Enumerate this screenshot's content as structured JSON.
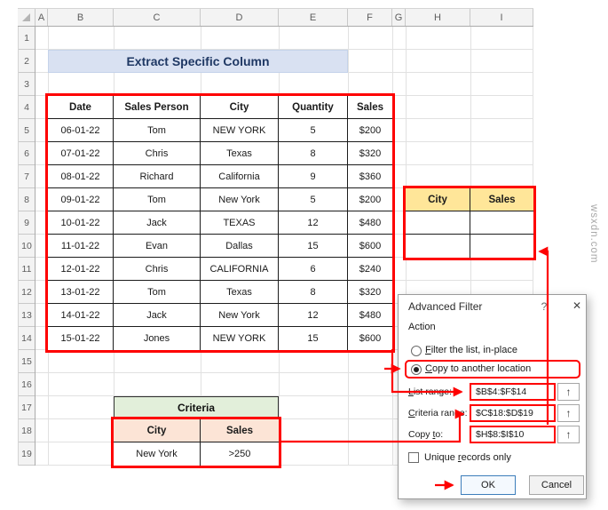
{
  "watermark": "wsxdn.com",
  "colors": {
    "annotation_red": "#FE0000",
    "title_banner_bg": "#D9E1F2",
    "title_text": "#1F3864",
    "output_header_bg": "#FFE699",
    "criteria_banner_bg": "#E2EFDA",
    "criteria_header_bg": "#FCE4D6",
    "ok_button_border": "#3D7EBB"
  },
  "grid": {
    "column_letters": [
      "A",
      "B",
      "C",
      "D",
      "E",
      "F",
      "G",
      "H",
      "I"
    ],
    "row_numbers": [
      "1",
      "2",
      "3",
      "4",
      "5",
      "6",
      "7",
      "8",
      "9",
      "10",
      "11",
      "12",
      "13",
      "14",
      "15",
      "16",
      "17",
      "18",
      "19"
    ]
  },
  "title_banner": "Extract Specific Column",
  "main_table": {
    "headers": [
      "Date",
      "Sales Person",
      "City",
      "Quantity",
      "Sales"
    ],
    "rows": [
      {
        "date": "06-01-22",
        "person": "Tom",
        "city": "NEW YORK",
        "qty": "5",
        "sales": "$200"
      },
      {
        "date": "07-01-22",
        "person": "Chris",
        "city": "Texas",
        "qty": "8",
        "sales": "$320"
      },
      {
        "date": "08-01-22",
        "person": "Richard",
        "city": "California",
        "qty": "9",
        "sales": "$360"
      },
      {
        "date": "09-01-22",
        "person": "Tom",
        "city": "New York",
        "qty": "5",
        "sales": "$200"
      },
      {
        "date": "10-01-22",
        "person": "Jack",
        "city": "TEXAS",
        "qty": "12",
        "sales": "$480"
      },
      {
        "date": "11-01-22",
        "person": "Evan",
        "city": "Dallas",
        "qty": "15",
        "sales": "$600"
      },
      {
        "date": "12-01-22",
        "person": "Chris",
        "city": "CALIFORNIA",
        "qty": "6",
        "sales": "$240"
      },
      {
        "date": "13-01-22",
        "person": "Tom",
        "city": "Texas",
        "qty": "8",
        "sales": "$320"
      },
      {
        "date": "14-01-22",
        "person": "Jack",
        "city": "New York",
        "qty": "12",
        "sales": "$480"
      },
      {
        "date": "15-01-22",
        "person": "Jones",
        "city": "NEW YORK",
        "qty": "15",
        "sales": "$600"
      }
    ]
  },
  "output_table": {
    "headers": [
      "City",
      "Sales"
    ]
  },
  "criteria": {
    "banner": "Criteria",
    "headers": [
      "City",
      "Sales"
    ],
    "row": {
      "city": "New York",
      "sales": ">250"
    }
  },
  "dialog": {
    "title": "Advanced Filter",
    "help_icon": "?",
    "close_icon": "✕",
    "action_label": "Action",
    "radio_filter": {
      "pre": "",
      "key": "F",
      "post": "ilter the list, in-place"
    },
    "radio_copy": {
      "pre": "",
      "key": "C",
      "post": "opy to another location"
    },
    "list_range": {
      "label_pre": "",
      "label_key": "L",
      "label_post": "ist range:",
      "value": "$B$4:$F$14"
    },
    "criteria_range": {
      "label_pre": "",
      "label_key": "C",
      "label_post": "riteria range:",
      "value": "$C$18:$D$19"
    },
    "copy_to": {
      "label_pre": "Copy ",
      "label_key": "t",
      "label_post": "o:",
      "value": "$H$8:$I$10"
    },
    "unique_checkbox": {
      "pre": "Unique ",
      "key": "r",
      "post": "ecords only"
    },
    "range_selector_icon": "↑",
    "ok_label": "OK",
    "cancel_label": "Cancel"
  }
}
